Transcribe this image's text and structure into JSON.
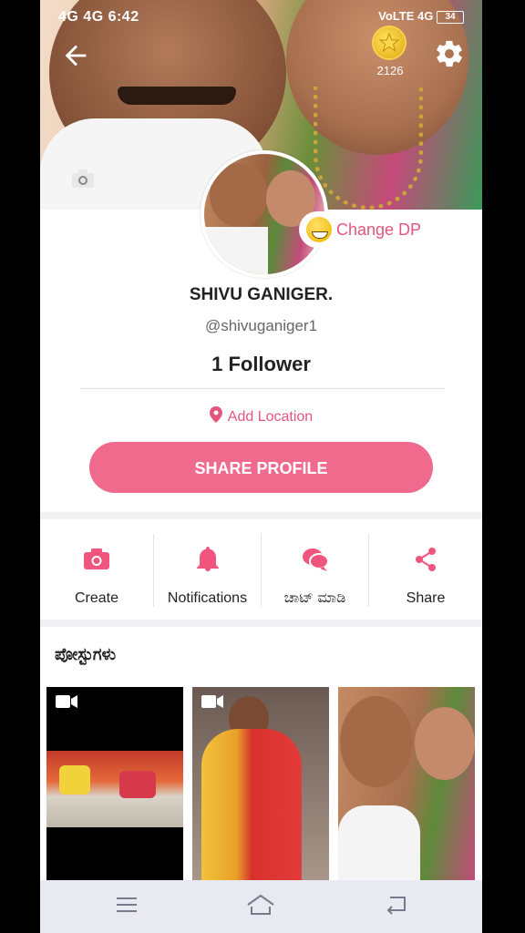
{
  "status_bar": {
    "left": "4G  4G  6:42",
    "right": "VoLTE 4G",
    "battery": "34"
  },
  "header": {
    "coin_count": "2126"
  },
  "profile": {
    "name": "SHIVU GANIGER.",
    "handle": "@shivuganiger1",
    "followers": "1 Follower",
    "change_dp_label": "Change DP",
    "add_location_label": "Add Location",
    "share_profile_label": "SHARE PROFILE"
  },
  "actions": [
    {
      "label": "Create",
      "icon": "camera-icon"
    },
    {
      "label": "Notifications",
      "icon": "bell-icon"
    },
    {
      "label": "ಚಾಟ್ ಮಾಡಿ",
      "icon": "chat-icon"
    },
    {
      "label": "Share",
      "icon": "share-icon"
    }
  ],
  "posts": {
    "title": "ಪೋಸ್ಟುಗಳು"
  },
  "colors": {
    "accent": "#f06a8e",
    "accent_text": "#e4567d"
  }
}
